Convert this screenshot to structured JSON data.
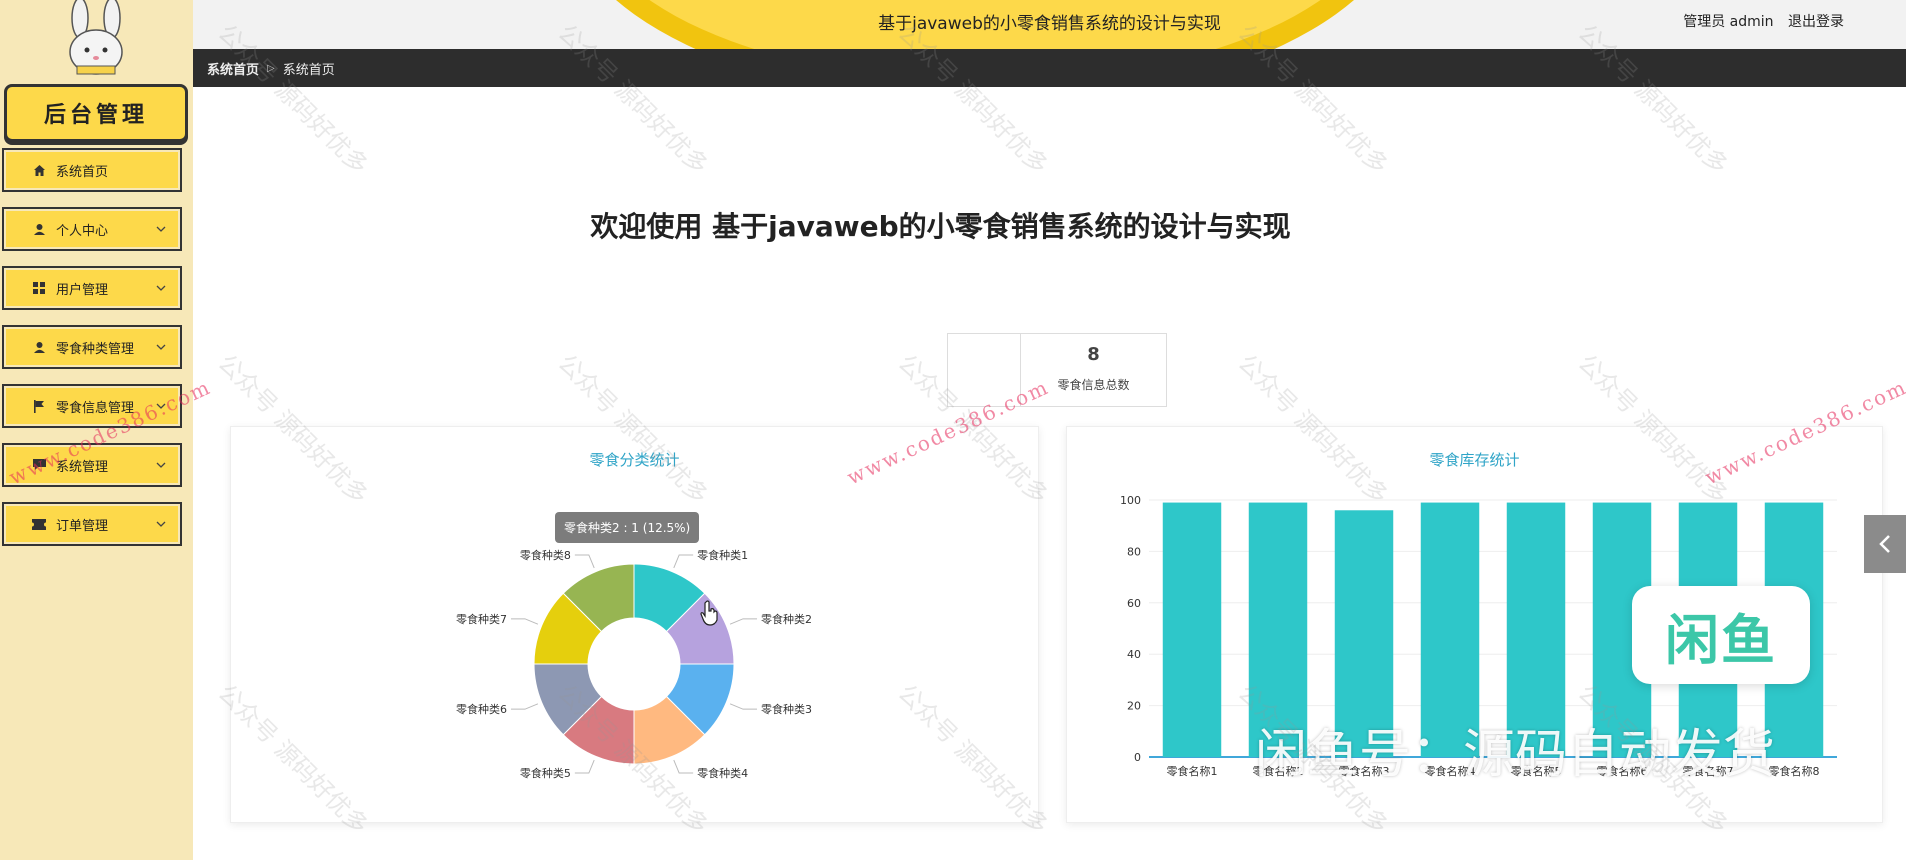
{
  "header": {
    "title": "基于javaweb的小零食销售系统的设计与实现",
    "user_label": "管理员 admin",
    "logout_label": "退出登录"
  },
  "sidebar": {
    "brand": "后台管理",
    "items": [
      {
        "label": "系统首页",
        "icon": "home-icon",
        "has_children": false
      },
      {
        "label": "个人中心",
        "icon": "person-icon",
        "has_children": true
      },
      {
        "label": "用户管理",
        "icon": "grid-icon",
        "has_children": true
      },
      {
        "label": "零食种类管理",
        "icon": "person-icon",
        "has_children": true
      },
      {
        "label": "零食信息管理",
        "icon": "flag-icon",
        "has_children": true
      },
      {
        "label": "系统管理",
        "icon": "chat-icon",
        "has_children": true
      },
      {
        "label": "订单管理",
        "icon": "ticket-icon",
        "has_children": true
      }
    ]
  },
  "breadcrumb": {
    "home": "系统首页",
    "current": "系统首页"
  },
  "main": {
    "welcome": "欢迎使用 基于javaweb的小零食销售系统的设计与实现",
    "stat": {
      "value": "8",
      "label": "零食信息总数"
    }
  },
  "chart_data": [
    {
      "type": "pie",
      "title": "零食分类统计",
      "donut": true,
      "slices": [
        {
          "label": "零食种类1",
          "value": 1,
          "color": "#2ec7c9"
        },
        {
          "label": "零食种类2",
          "value": 1,
          "color": "#b6a2de"
        },
        {
          "label": "零食种类3",
          "value": 1,
          "color": "#5ab1ef"
        },
        {
          "label": "零食种类4",
          "value": 1,
          "color": "#ffb980"
        },
        {
          "label": "零食种类5",
          "value": 1,
          "color": "#d87a80"
        },
        {
          "label": "零食种类6",
          "value": 1,
          "color": "#8d98b3"
        },
        {
          "label": "零食种类7",
          "value": 1,
          "color": "#e5cf0d"
        },
        {
          "label": "零食种类8",
          "value": 1,
          "color": "#97b552"
        }
      ],
      "tooltip": "零食种类2 : 1 (12.5%)"
    },
    {
      "type": "bar",
      "title": "零食库存统计",
      "categories": [
        "零食名称1",
        "零食名称2",
        "零食名称3",
        "零食名称4",
        "零食名称5",
        "零食名称6",
        "零食名称7",
        "零食名称8"
      ],
      "values": [
        99,
        99,
        96,
        99,
        99,
        99,
        99,
        99
      ],
      "yticks": [
        0,
        20,
        40,
        60,
        80,
        100
      ],
      "ylim": [
        0,
        100
      ],
      "color": "#2ec7c9"
    }
  ],
  "overlay": {
    "logo_text": "闲鱼",
    "caption": "闲鱼号：源码自动发货",
    "watermark_cn": "公众号 源码好优多",
    "watermark_url": "www.code386.com"
  },
  "colors": {
    "accent": "#fdd94a",
    "dark_bar": "#2d2d2d",
    "teal": "#2ec7c9"
  }
}
